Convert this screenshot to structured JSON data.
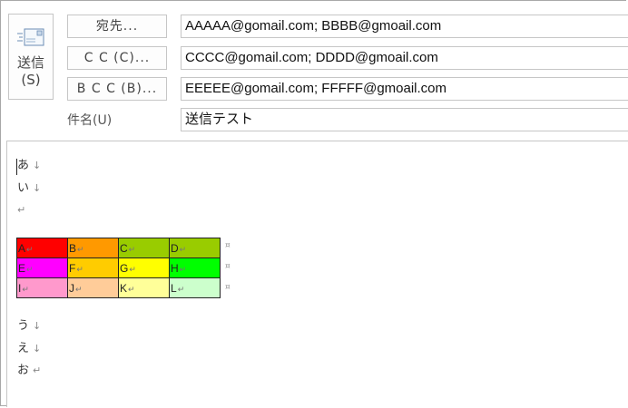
{
  "send_button": {
    "label": "送信\n(S)"
  },
  "fields": {
    "to": {
      "label": "宛先...",
      "value": "AAAAA@gomail.com; BBBB@gmoail.com"
    },
    "cc": {
      "label": "C C (C)...",
      "value": "CCCC@gomail.com; DDDD@gmoail.com"
    },
    "bcc": {
      "label": "B C C (B)...",
      "value": "EEEEE@gomail.com; FFFFF@gmoail.com"
    },
    "subject": {
      "label": "件名(U)",
      "value": "送信テスト"
    }
  },
  "body": {
    "lines_before": [
      {
        "text": "あ",
        "mark": "↓"
      },
      {
        "text": "い",
        "mark": "↓"
      },
      {
        "text": "",
        "mark": "↵"
      }
    ],
    "table": {
      "rows": [
        [
          {
            "text": "A",
            "bg": "#ff0000"
          },
          {
            "text": "B",
            "bg": "#ff9900"
          },
          {
            "text": "C",
            "bg": "#99cc00"
          },
          {
            "text": "D",
            "bg": "#99cc00"
          }
        ],
        [
          {
            "text": "E",
            "bg": "#ff00ff"
          },
          {
            "text": "F",
            "bg": "#ffcc00"
          },
          {
            "text": "G",
            "bg": "#ffff00"
          },
          {
            "text": "H",
            "bg": "#00ff00"
          }
        ],
        [
          {
            "text": "I",
            "bg": "#ff99cc"
          },
          {
            "text": "J",
            "bg": "#ffcc99"
          },
          {
            "text": "K",
            "bg": "#ffff99"
          },
          {
            "text": "L",
            "bg": "#ccffcc"
          }
        ]
      ],
      "cell_mark": "↵",
      "row_end_mark": "¤"
    },
    "lines_after": [
      {
        "text": "う",
        "mark": "↓"
      },
      {
        "text": "え",
        "mark": "↓"
      },
      {
        "text": "お",
        "mark": "↵"
      }
    ]
  },
  "colors": {
    "border": "#c6c6c6",
    "button_bg": "#fdfdfd"
  },
  "icons": {
    "send": "envelope-send-icon"
  }
}
